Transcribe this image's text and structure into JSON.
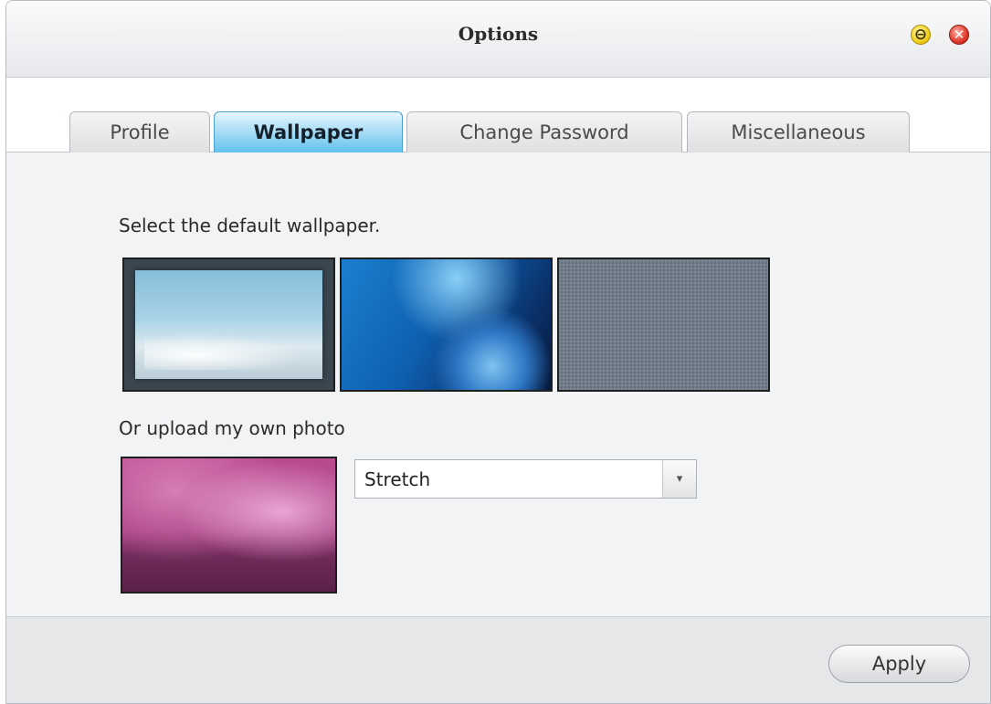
{
  "window": {
    "title": "Options",
    "minimize_glyph": "⊖",
    "close_glyph": "✕"
  },
  "tabs": [
    {
      "label": "Profile",
      "active": false
    },
    {
      "label": "Wallpaper",
      "active": true
    },
    {
      "label": "Change Password",
      "active": false
    },
    {
      "label": "Miscellaneous",
      "active": false
    }
  ],
  "wallpaper": {
    "default_prompt": "Select the default wallpaper.",
    "upload_prompt": "Or upload my own photo",
    "display_mode": {
      "selected": "Stretch",
      "arrow_glyph": "▾"
    }
  },
  "footer": {
    "apply_label": "Apply"
  },
  "colors": {
    "active_tab": "#62c1ee",
    "close_button": "#e0392b",
    "minimize_button": "#f0cf1c"
  }
}
